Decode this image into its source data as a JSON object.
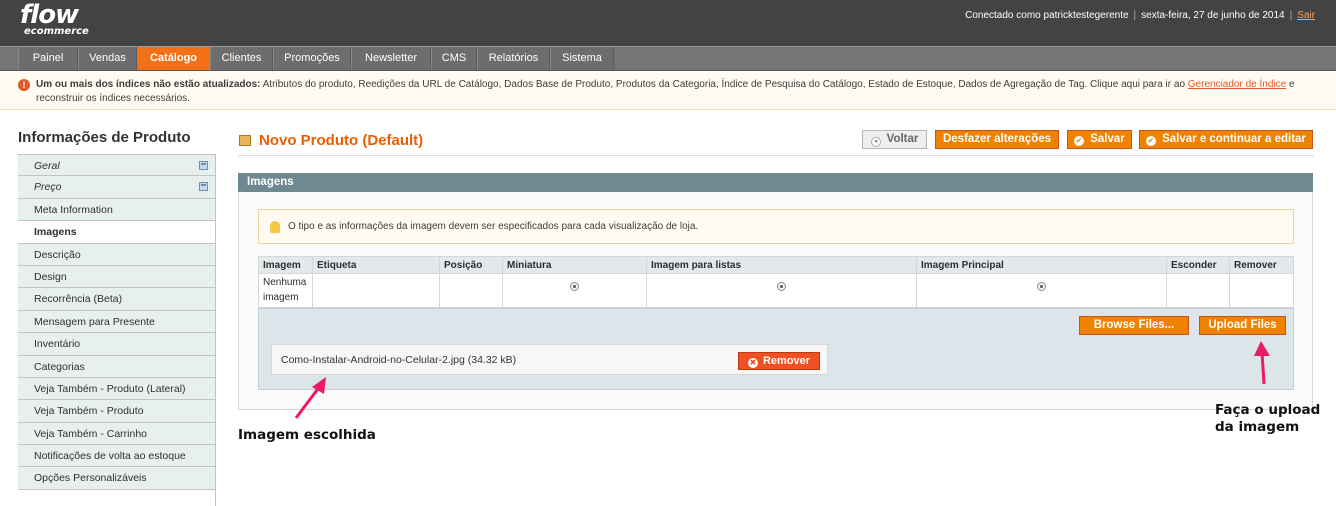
{
  "header": {
    "logo_line1": "flow",
    "logo_line2": "ecommerce",
    "logged_in": "Conectado como patricktestegerente",
    "date": "sexta-feira, 27 de junho de 2014",
    "logout": "Sair"
  },
  "nav": {
    "items": [
      "Painel",
      "Vendas",
      "Catálogo",
      "Clientes",
      "Promoções",
      "Newsletter",
      "CMS",
      "Relatórios",
      "Sistema"
    ],
    "active": "Catálogo"
  },
  "notice": {
    "bold": "Um ou mais dos índices não estão atualizados:",
    "text": " Atributos do produto, Reedições da URL de Catálogo, Dados Base de Produto, Produtos da Categoria, Índice de Pesquisa do Catálogo, Estado de Estoque, Dados de Agregação de Tag. Clique aqui para ir ao ",
    "link": "Gerenciador de Índice",
    "tail": " e reconstruir os índices necessários."
  },
  "sidebar": {
    "title": "Informações de Produto",
    "items": [
      {
        "label": "Geral"
      },
      {
        "label": "Preço"
      },
      {
        "label": "Meta Information"
      },
      {
        "label": "Imagens"
      },
      {
        "label": "Descrição"
      },
      {
        "label": "Design"
      },
      {
        "label": "Recorrência (Beta)"
      },
      {
        "label": "Mensagem para Presente"
      },
      {
        "label": "Inventário"
      },
      {
        "label": "Categorias"
      },
      {
        "label": "Veja Também - Produto (Lateral)"
      },
      {
        "label": "Veja Também - Produto"
      },
      {
        "label": "Veja Também - Carrinho"
      },
      {
        "label": "Notificações de volta ao estoque"
      },
      {
        "label": "Opções Personalizáveis"
      }
    ]
  },
  "page": {
    "title": "Novo Produto (Default)",
    "buttons": {
      "back": "Voltar",
      "reset": "Desfazer alterações",
      "save": "Salvar",
      "save_continue": "Salvar e continuar a editar"
    }
  },
  "images": {
    "section_title": "Imagens",
    "info": "O tipo e as informações da imagem devem ser especificados para cada visualização de loja.",
    "columns": [
      "Imagem",
      "Etiqueta",
      "Posição",
      "Miniatura",
      "Imagem para listas",
      "Imagem Principal",
      "Esconder",
      "Remover"
    ],
    "no_image": "Nenhuma imagem",
    "browse_button": "Browse Files...",
    "upload_button": "Upload Files",
    "file_name": "Como-Instalar-Android-no-Celular-2.jpg (34.32 kB)",
    "remove_button": "Remover"
  },
  "annotations": {
    "chosen": "Imagem escolhida",
    "upload_line1": "Faça o upload",
    "upload_line2": "da imagem"
  },
  "colors": {
    "header": "#434343",
    "nav": "#757575",
    "accent": "#f27018",
    "section_head": "#6f8992",
    "annotation_arrow": "#ec1a63"
  }
}
